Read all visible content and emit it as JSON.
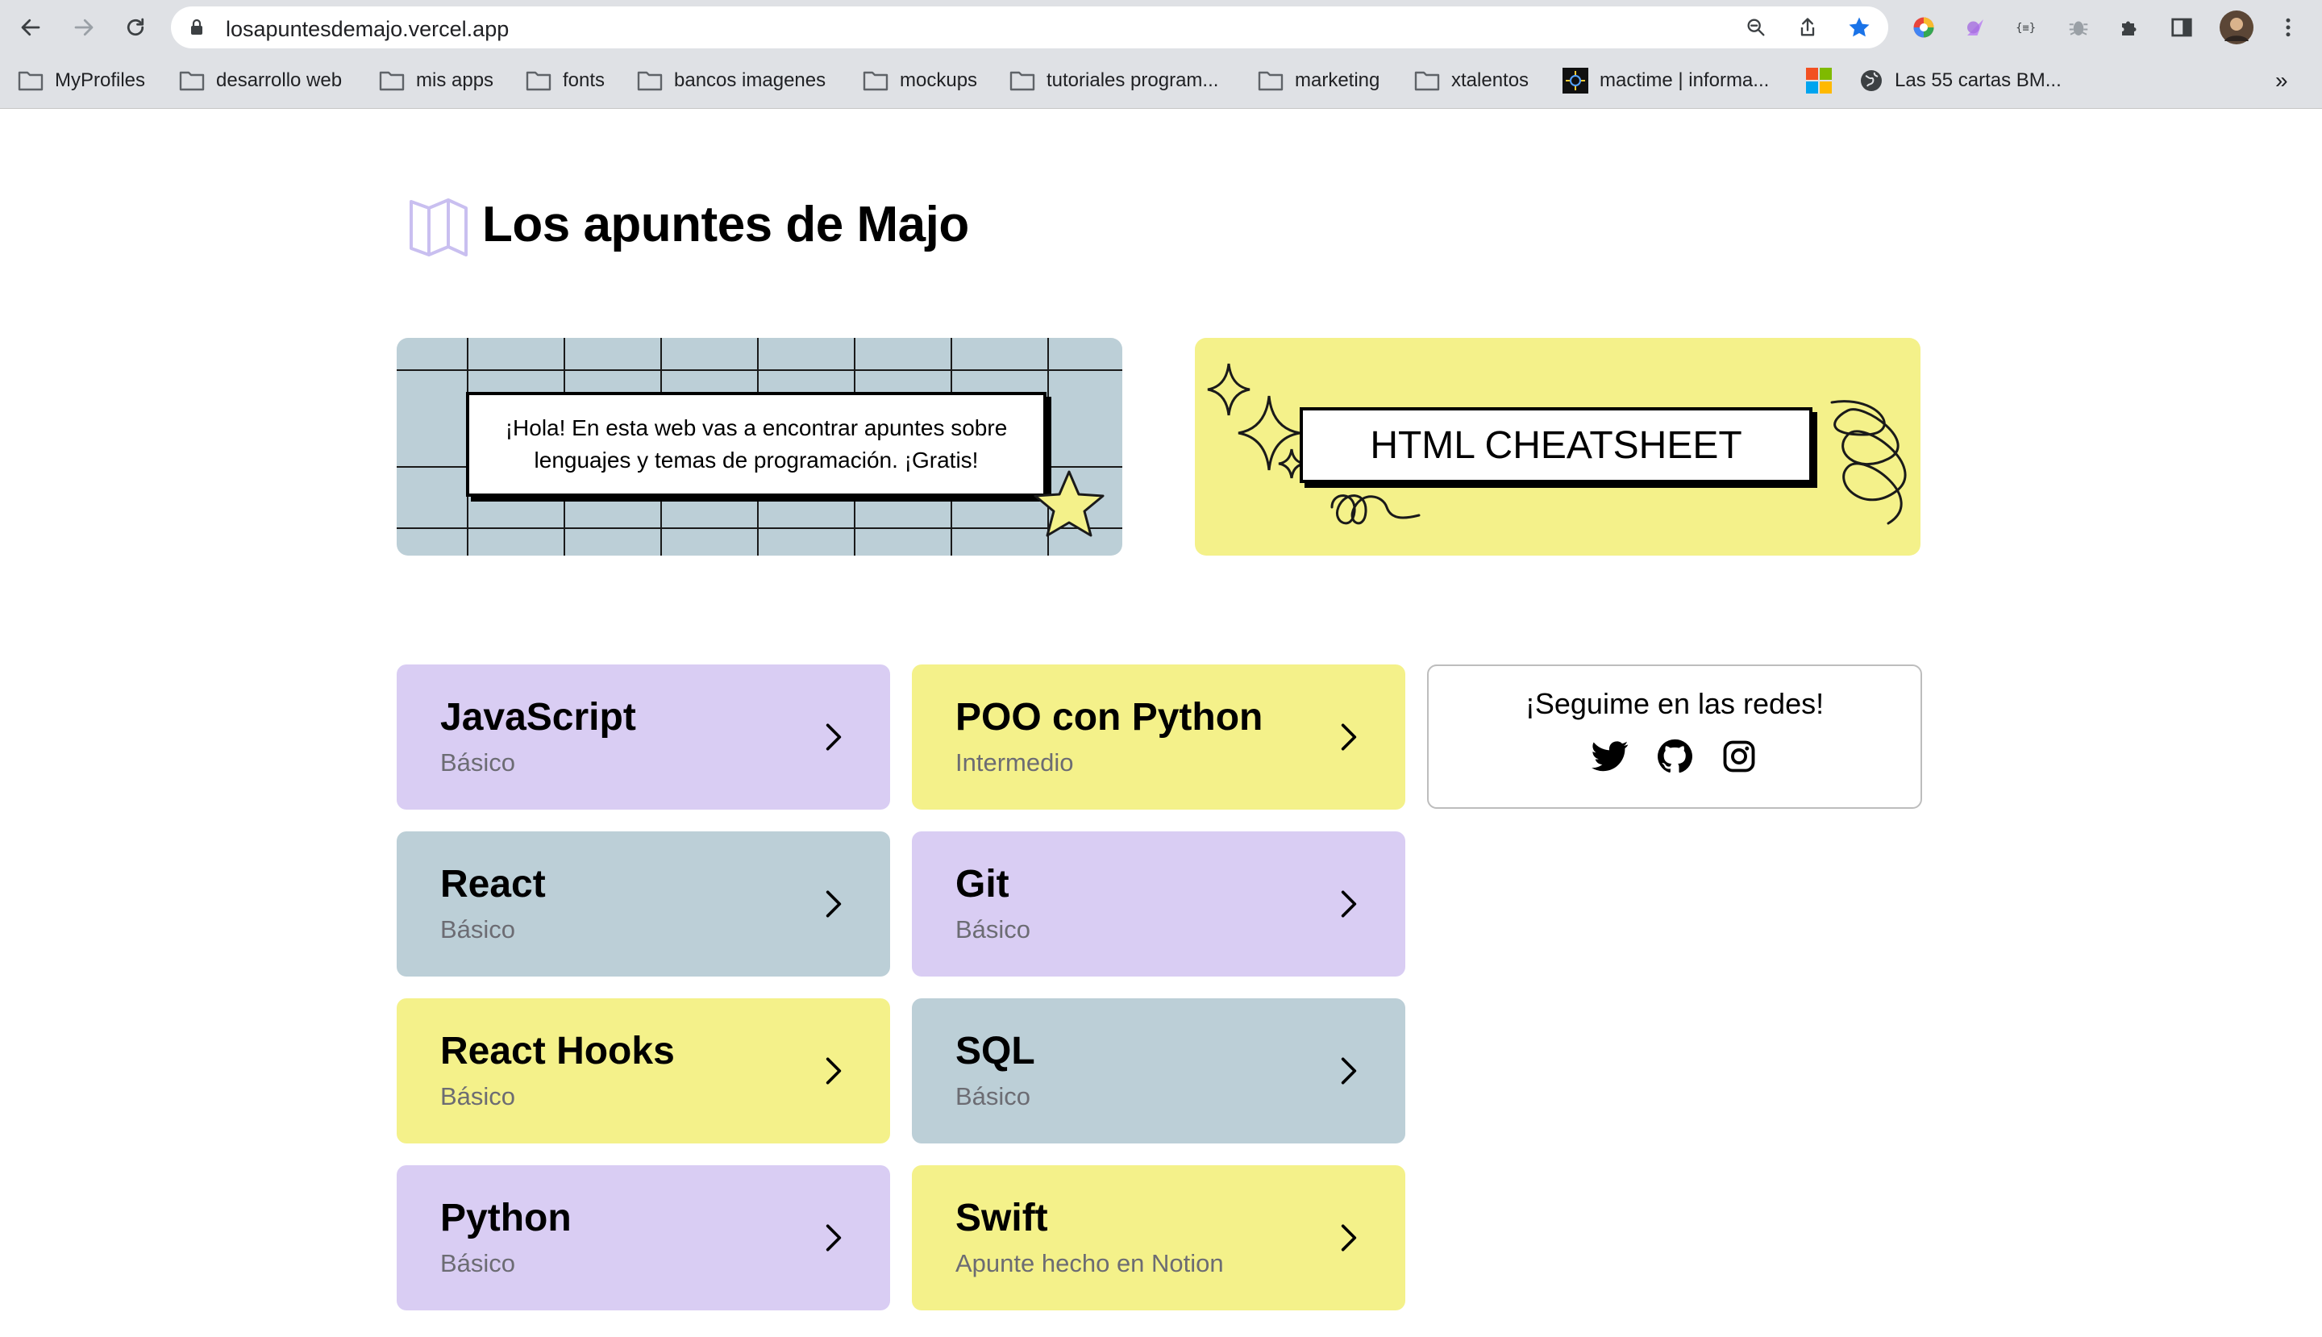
{
  "browser": {
    "url": "losapuntesdemajo.vercel.app",
    "bookmarks": [
      {
        "label": "MyProfiles",
        "icon": "folder-icon"
      },
      {
        "label": "desarrollo web",
        "icon": "folder-icon"
      },
      {
        "label": "mis apps",
        "icon": "folder-icon"
      },
      {
        "label": "fonts",
        "icon": "folder-icon"
      },
      {
        "label": "bancos imagenes",
        "icon": "folder-icon"
      },
      {
        "label": "mockups",
        "icon": "folder-icon"
      },
      {
        "label": "tutoriales program...",
        "icon": "folder-icon"
      },
      {
        "label": "marketing",
        "icon": "folder-icon"
      },
      {
        "label": "xtalentos",
        "icon": "folder-icon"
      },
      {
        "label": "mactime | informa...",
        "icon": "site-favicon"
      },
      {
        "label": "",
        "icon": "microsoft-icon"
      },
      {
        "label": "Las 55 cartas BM...",
        "icon": "globe-icon"
      }
    ],
    "overflow_label": "»",
    "accent_color": "#1a73e8"
  },
  "site": {
    "title": "Los apuntes de Majo",
    "intro": "¡Hola! En esta web vas a encontrar apuntes sobre lenguajes y temas de programación. ¡Gratis!",
    "cheatsheet_label": "HTML CHEATSHEET",
    "social_title": "¡Seguime en las redes!",
    "social_icons": [
      "twitter-icon",
      "github-icon",
      "instagram-icon"
    ]
  },
  "cards": [
    {
      "title": "JavaScript",
      "subtitle": "Básico",
      "color": "#d9cdf3"
    },
    {
      "title": "POO con Python",
      "subtitle": "Intermedio",
      "color": "#f4f18a"
    },
    {
      "title": "React",
      "subtitle": "Básico",
      "color": "#bccfd7"
    },
    {
      "title": "Git",
      "subtitle": "Básico",
      "color": "#d9cdf3"
    },
    {
      "title": "React Hooks",
      "subtitle": "Básico",
      "color": "#f4f18a"
    },
    {
      "title": "SQL",
      "subtitle": "Básico",
      "color": "#bccfd7"
    },
    {
      "title": "Python",
      "subtitle": "Básico",
      "color": "#d9cdf3"
    },
    {
      "title": "Swift",
      "subtitle": "Apunte hecho en Notion",
      "color": "#f4f18a"
    }
  ]
}
